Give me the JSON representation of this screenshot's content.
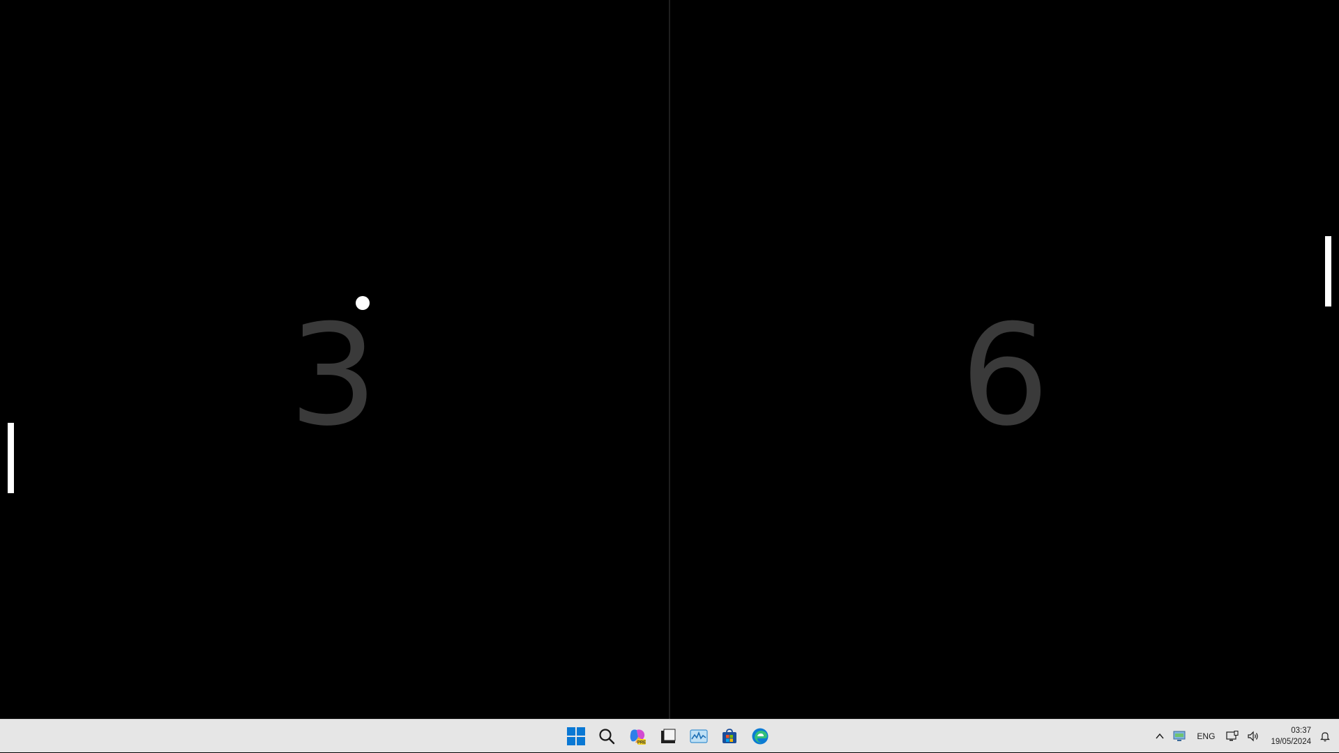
{
  "game": {
    "left_score": "3",
    "right_score": "6"
  },
  "taskbar": {
    "apps": [
      {
        "name": "start",
        "icon": "windows-logo-icon"
      },
      {
        "name": "search",
        "icon": "search-icon"
      },
      {
        "name": "copilot",
        "icon": "copilot-icon",
        "badge": "PRE"
      },
      {
        "name": "app-window",
        "icon": "window-icon"
      },
      {
        "name": "performance",
        "icon": "chart-icon"
      },
      {
        "name": "store",
        "icon": "store-icon"
      },
      {
        "name": "edge",
        "icon": "edge-icon"
      }
    ],
    "tray": {
      "language": "ENG",
      "time": "03:37",
      "date": "19/05/2024"
    }
  }
}
